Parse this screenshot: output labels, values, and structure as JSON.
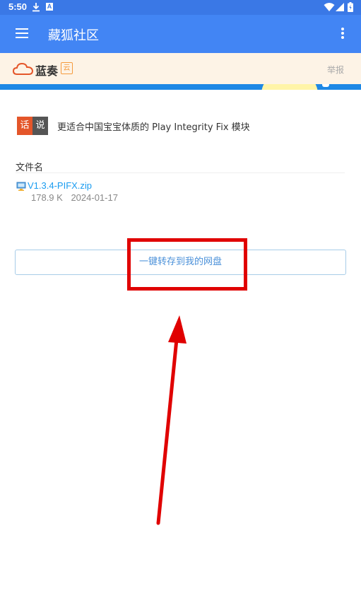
{
  "status_bar": {
    "time": "5:50",
    "download_icon": "download-icon",
    "a_icon_text": "A",
    "wifi_icon": "wifi-icon",
    "signal_icon": "signal-icon",
    "battery_icon": "battery-icon"
  },
  "app_bar": {
    "title": "藏狐社区",
    "menu_icon": "hamburger-menu-icon",
    "more_icon": "more-vertical-icon",
    "background": "#4285f4"
  },
  "site_header": {
    "logo_text": "蓝奏",
    "logo_yun": "云",
    "report_label": "举报",
    "background": "#fdf3e6"
  },
  "description": {
    "badge_1": "话",
    "badge_2": "说",
    "text": "更适合中国宝宝体质的 Play Integrity Fix 模块"
  },
  "file_section": {
    "label": "文件名",
    "file_name": "V1.3.4-PIFX.zip",
    "file_size": "178.9 K",
    "file_date": "2024-01-17"
  },
  "actions": {
    "save_to_disk_label": "一键转存到我的网盘"
  },
  "annotations": {
    "highlight_color": "#e00000",
    "arrow_color": "#e00000"
  }
}
